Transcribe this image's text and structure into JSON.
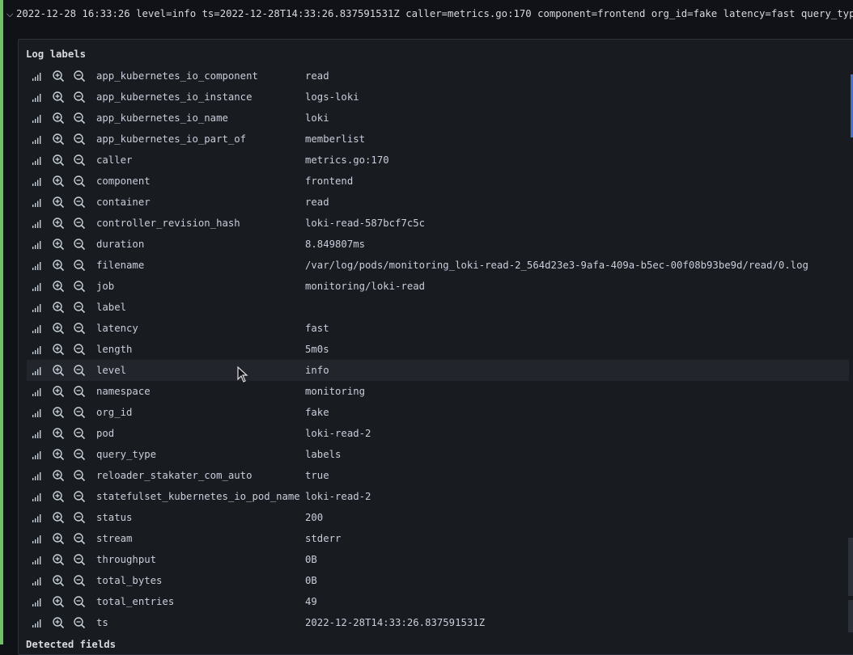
{
  "log_line": {
    "text": "2022-12-28 16:33:26 level=info ts=2022-12-28T14:33:26.837591531Z caller=metrics.go:170 component=frontend org_id=fake latency=fast query_typ"
  },
  "log_labels": {
    "title": "Log labels",
    "rows": [
      {
        "key": "app_kubernetes_io_component",
        "value": "read"
      },
      {
        "key": "app_kubernetes_io_instance",
        "value": "logs-loki"
      },
      {
        "key": "app_kubernetes_io_name",
        "value": "loki"
      },
      {
        "key": "app_kubernetes_io_part_of",
        "value": "memberlist"
      },
      {
        "key": "caller",
        "value": "metrics.go:170"
      },
      {
        "key": "component",
        "value": "frontend"
      },
      {
        "key": "container",
        "value": "read"
      },
      {
        "key": "controller_revision_hash",
        "value": "loki-read-587bcf7c5c"
      },
      {
        "key": "duration",
        "value": "8.849807ms"
      },
      {
        "key": "filename",
        "value": "/var/log/pods/monitoring_loki-read-2_564d23e3-9afa-409a-b5ec-00f08b93be9d/read/0.log"
      },
      {
        "key": "job",
        "value": "monitoring/loki-read"
      },
      {
        "key": "label",
        "value": ""
      },
      {
        "key": "latency",
        "value": "fast"
      },
      {
        "key": "length",
        "value": "5m0s"
      },
      {
        "key": "level",
        "value": "info"
      },
      {
        "key": "namespace",
        "value": "monitoring"
      },
      {
        "key": "org_id",
        "value": "fake"
      },
      {
        "key": "pod",
        "value": "loki-read-2"
      },
      {
        "key": "query_type",
        "value": "labels"
      },
      {
        "key": "reloader_stakater_com_auto",
        "value": "true"
      },
      {
        "key": "statefulset_kubernetes_io_pod_name",
        "value": "loki-read-2"
      },
      {
        "key": "status",
        "value": "200"
      },
      {
        "key": "stream",
        "value": "stderr"
      },
      {
        "key": "throughput",
        "value": "0B"
      },
      {
        "key": "total_bytes",
        "value": "0B"
      },
      {
        "key": "total_entries",
        "value": "49"
      },
      {
        "key": "ts",
        "value": "2022-12-28T14:33:26.837591531Z"
      }
    ]
  },
  "detected_fields": {
    "title": "Detected fields"
  },
  "icons": {
    "row_expanded": "chevron-down-icon",
    "stats": "signal-bars-icon",
    "filter_for": "zoom-in-icon",
    "filter_out": "zoom-out-icon"
  },
  "colors": {
    "background": "#111217",
    "panel": "#181b1f",
    "level_info": "#73bf69",
    "text": "#ccccdc",
    "scrollbar_thumb": "#3d71d9"
  }
}
